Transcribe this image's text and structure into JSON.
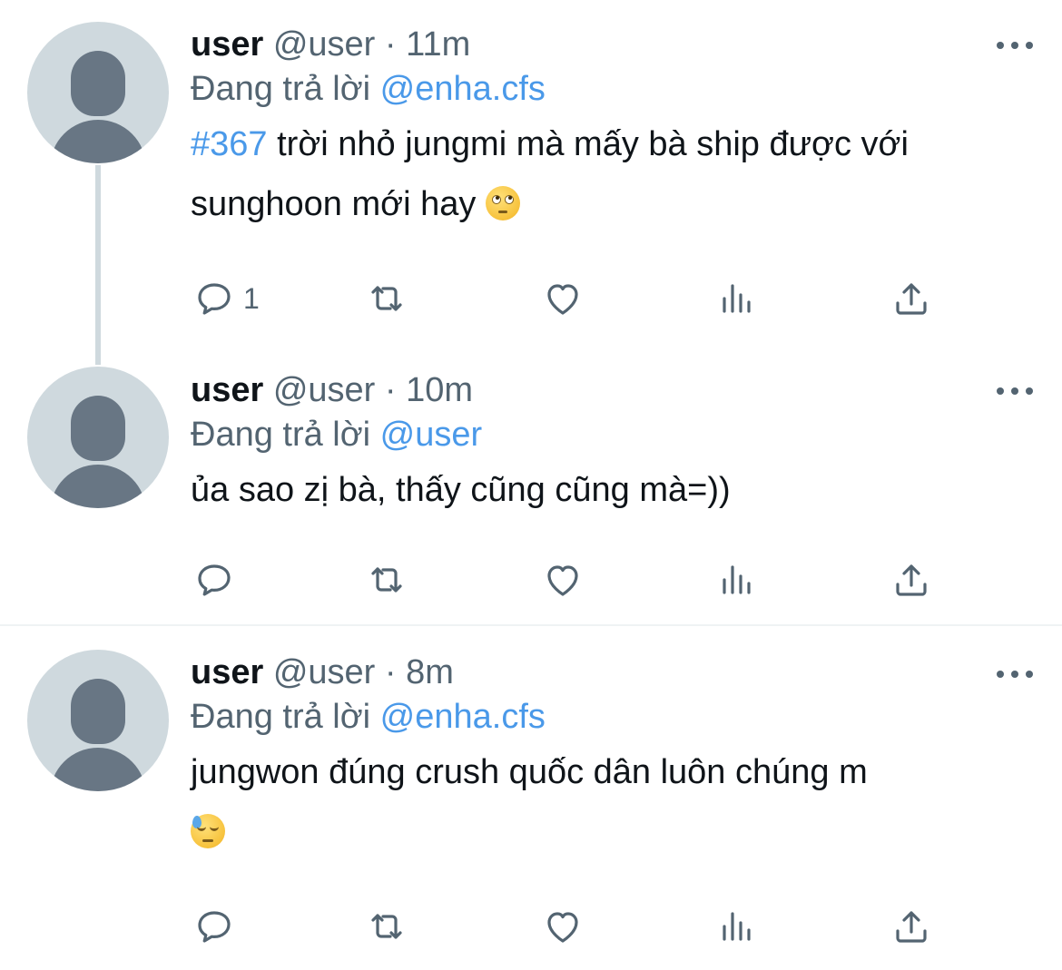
{
  "tweets": [
    {
      "display_name": "user",
      "handle": "@user",
      "dot": "·",
      "time": "11m",
      "replying_prefix": "Đang trả lời",
      "replying_to": "@enha.cfs",
      "hashtag": "#367",
      "text": "trời nhỏ jungmi mà mấy bà ship được với sunghoon mới hay",
      "emoji": "face-with-rolling-eyes",
      "reply_count": "1"
    },
    {
      "display_name": "user",
      "handle": "@user",
      "dot": "·",
      "time": "10m",
      "replying_prefix": "Đang trả lời",
      "replying_to": "@user",
      "text": "ủa sao zị bà, thấy cũng cũng mà=))"
    },
    {
      "display_name": "user",
      "handle": "@user",
      "dot": "·",
      "time": "8m",
      "replying_prefix": "Đang trả lời",
      "replying_to": "@enha.cfs",
      "text": "jungwon đúng crush quốc dân luôn chúng m",
      "emoji": "downcast-face-with-sweat"
    }
  ],
  "icons": {
    "reply": "reply-icon",
    "retweet": "retweet-icon",
    "like": "heart-icon",
    "views": "views-icon",
    "share": "share-icon",
    "more": "more-icon"
  },
  "colors": {
    "link": "#4a99e9",
    "secondary_text": "#536471",
    "avatar_bg": "#cfd9de",
    "avatar_fg": "#687684"
  }
}
